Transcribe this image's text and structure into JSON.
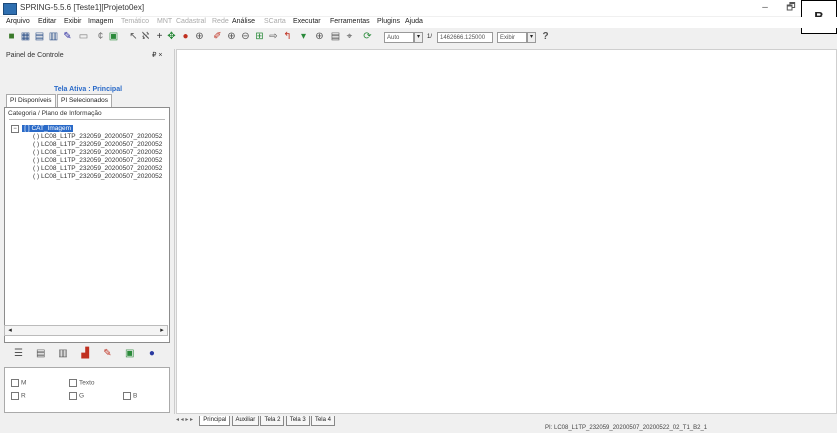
{
  "window": {
    "title": "SPRING-5.5.6 [Teste1][Projeto0ex]",
    "minimize": "–",
    "restore": "🗗"
  },
  "menu": [
    "Arquivo",
    "Editar",
    "Exibir",
    "Imagem",
    "Temático",
    "MNT",
    "Cadastral",
    "Rede",
    "Análise",
    "SCarta",
    "Executar",
    "Ferramentas",
    "Plugins",
    "Ajuda"
  ],
  "menu_disabled": [
    4,
    5,
    6,
    7,
    9
  ],
  "toolbar": {
    "scale_mode": "Auto",
    "scale_prefix": "1/",
    "scale_value": "1462666.125000",
    "zoom_mode": "Exibir",
    "help": "?"
  },
  "panel": {
    "header": "Painel de Controle",
    "pin": "₽ ×",
    "title": "Tela Ativa : Principal",
    "tabs": [
      "PI Disponíveis",
      "PI Selecionados"
    ],
    "tree_header": "Categoria / Plano de Informação",
    "root": "[ ] CAT_Imagem",
    "items": [
      "( ) LC08_L1TP_232059_20200507_2020052",
      "( ) LC08_L1TP_232059_20200507_2020052",
      "( ) LC08_L1TP_232059_20200507_2020052",
      "( ) LC08_L1TP_232059_20200507_2020052",
      "( ) LC08_L1TP_232059_20200507_2020052",
      "( ) LC08_L1TP_232059_20200507_2020052"
    ],
    "checks": {
      "m": "M",
      "texto": "Texto",
      "r": "R",
      "g": "G",
      "b": "B"
    }
  },
  "bottom_tabs": [
    "Principal",
    "Auxiliar",
    "Tela 2",
    "Tela 3",
    "Tela 4"
  ],
  "status": "PI: LC08_L1TP_232059_20200507_20200522_02_T1_B2_1"
}
